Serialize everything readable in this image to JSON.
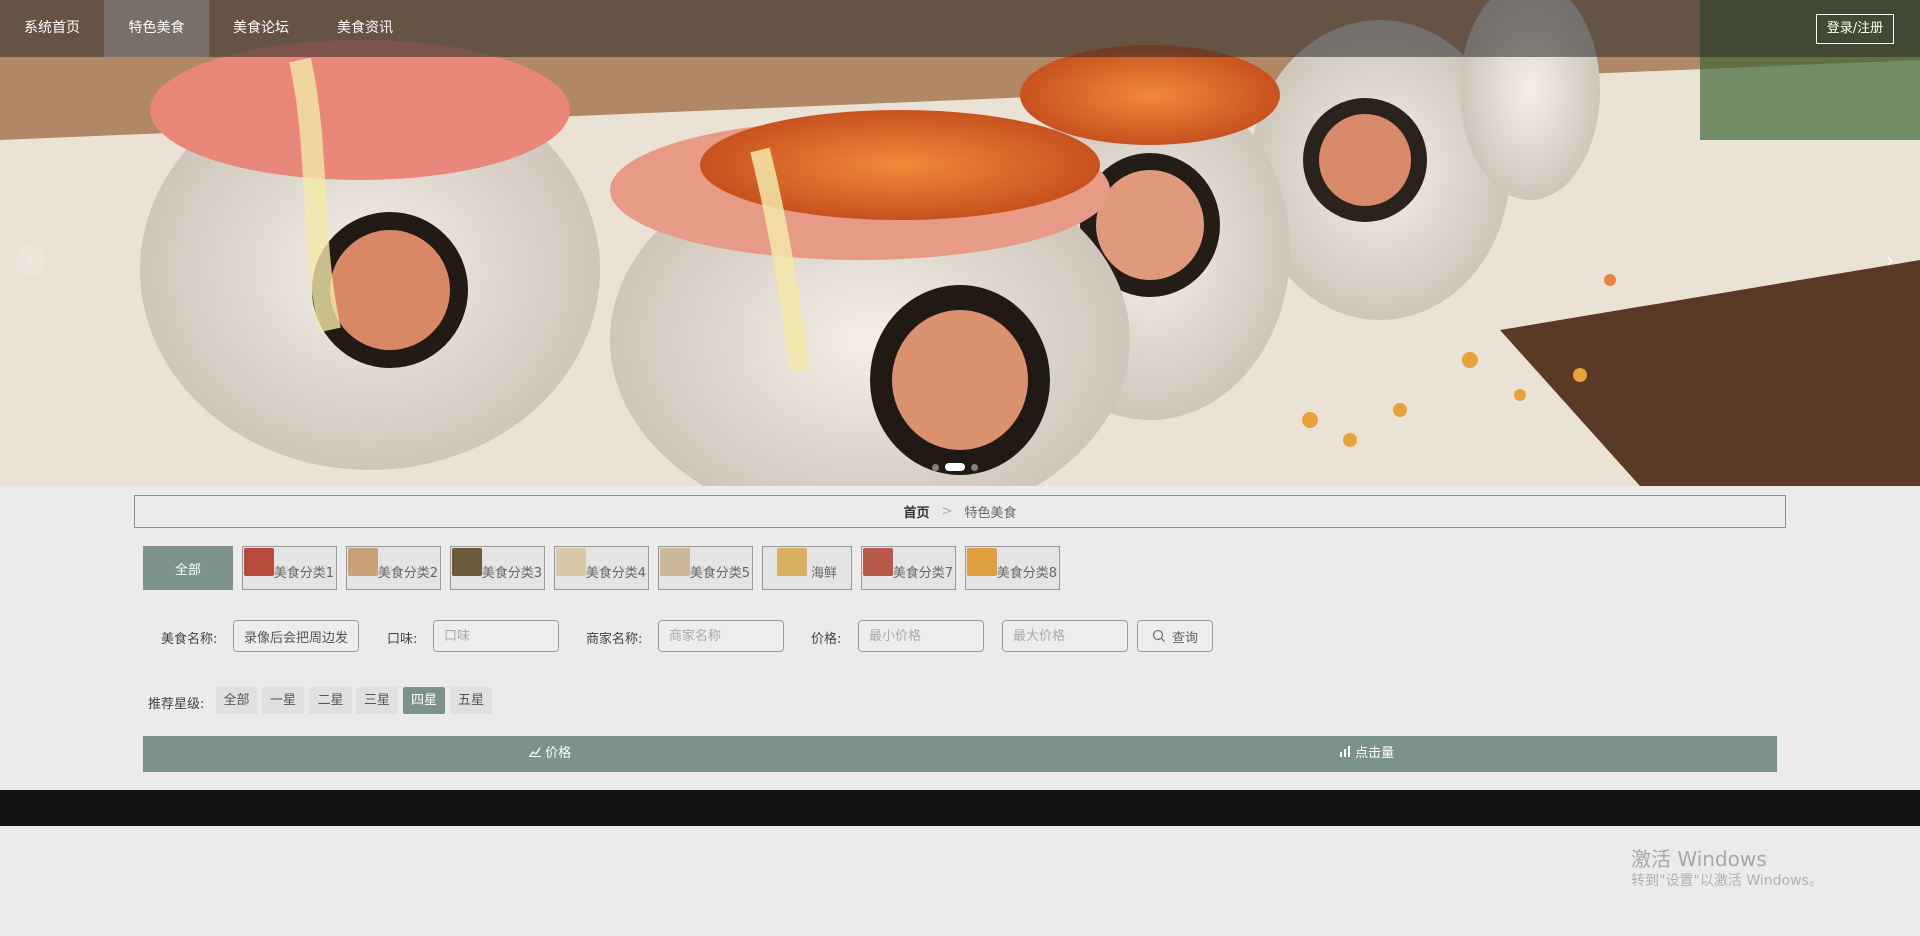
{
  "nav": {
    "items": [
      {
        "label": "系统首页"
      },
      {
        "label": "特色美食"
      },
      {
        "label": "美食论坛"
      },
      {
        "label": "美食资讯"
      }
    ],
    "login_label": "登录/注册"
  },
  "carousel": {
    "prev_icon": "‹",
    "next_icon": "›",
    "active_index": 1
  },
  "breadcrumb": {
    "home": "首页",
    "separator": ">",
    "current": "特色美食"
  },
  "categories": [
    {
      "label": "全部"
    },
    {
      "label": "美食分类1",
      "color": "#b84a3a"
    },
    {
      "label": "美食分类2",
      "color": "#c9a27a"
    },
    {
      "label": "美食分类3",
      "color": "#6a5a3a"
    },
    {
      "label": "美食分类4",
      "color": "#d8c8a8"
    },
    {
      "label": "美食分类5",
      "color": "#cbb89a"
    },
    {
      "label": "海鲜",
      "color": "#d8b060"
    },
    {
      "label": "美食分类7",
      "color": "#b85a4a"
    },
    {
      "label": "美食分类8",
      "color": "#e0a040"
    }
  ],
  "search": {
    "name_label": "美食名称:",
    "name_value": "录像后会把周边发",
    "taste_label": "口味:",
    "taste_placeholder": "口味",
    "merchant_label": "商家名称:",
    "merchant_placeholder": "商家名称",
    "price_label": "价格:",
    "min_placeholder": "最小价格",
    "max_placeholder": "最大价格",
    "button_label": "查询"
  },
  "stars": {
    "label": "推荐星级:",
    "options": [
      "全部",
      "一星",
      "二星",
      "三星",
      "四星",
      "五星"
    ],
    "active": "四星"
  },
  "sort": {
    "price_label": "价格",
    "clicks_label": "点击量"
  },
  "watermark": {
    "title": "激活 Windows",
    "subtitle": "转到\"设置\"以激活 Windows。"
  },
  "colors": {
    "accent": "#7b938b",
    "footer": "#121212"
  }
}
